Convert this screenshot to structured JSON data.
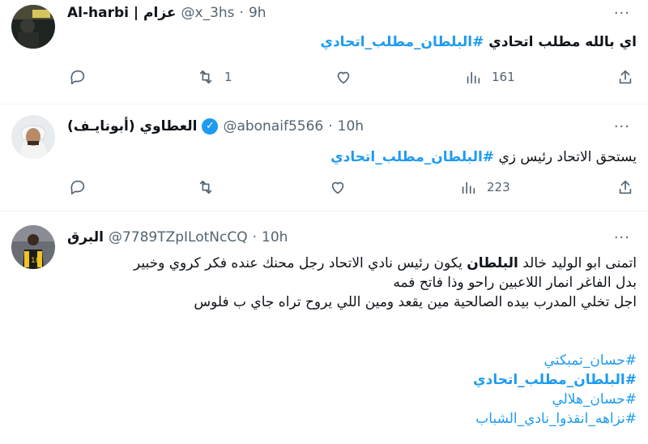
{
  "tweets": [
    {
      "display_name": "Al-harbi | عزام",
      "handle": "@x_3hs",
      "time": "9h",
      "more": "···",
      "text_plain": "اي بالله مطلب اتحادي ",
      "text_tag": "#البلطان_مطلب_اتحادي",
      "replies": "",
      "retweets": "1",
      "likes": "",
      "views": "161"
    },
    {
      "display_name": "العطاوي (أبونايـف)",
      "verified": "✓",
      "handle": "@abonaif5566",
      "time": "10h",
      "more": "···",
      "text_plain": "يستحق الاتحاد رئيس زي ",
      "text_tag": "#البلطان_مطلب_اتحادي",
      "replies": "",
      "retweets": "",
      "likes": "",
      "views": "223"
    },
    {
      "display_name": "البرق",
      "handle": "@7789TZpILotNcCQ",
      "time": "10h",
      "more": "···",
      "line1_a": "اتمنى ابو الوليد خالد ",
      "line1_bold": "البلطان",
      "line1_b": " يكون رئيس نادي الاتحاد رجل محنك عنده فكر كروي وخبير",
      "line2": "بدل الفاغر انمار  اللاعبين راحو وذا فاتح فمه",
      "line3": "اجل تخلي المدرب بيده الصالحية مين يقعد ومين اللي يروح تراه جاي ب فلوس",
      "hashtags": [
        "#حسان_تمبكتي",
        "#البلطان_مطلب_اتحادي",
        "#حسان_هلالي",
        "#نزاهه_انقذوا_نادي_الشباب"
      ]
    }
  ],
  "icons": {
    "reply": "reply-icon",
    "retweet": "retweet-icon",
    "like": "heart-icon",
    "views": "views-icon",
    "share": "share-icon",
    "more": "more-icon"
  },
  "colors": {
    "link": "#1d9bf0",
    "muted": "#536471",
    "text": "#0f1419",
    "divider": "#eff3f4"
  }
}
